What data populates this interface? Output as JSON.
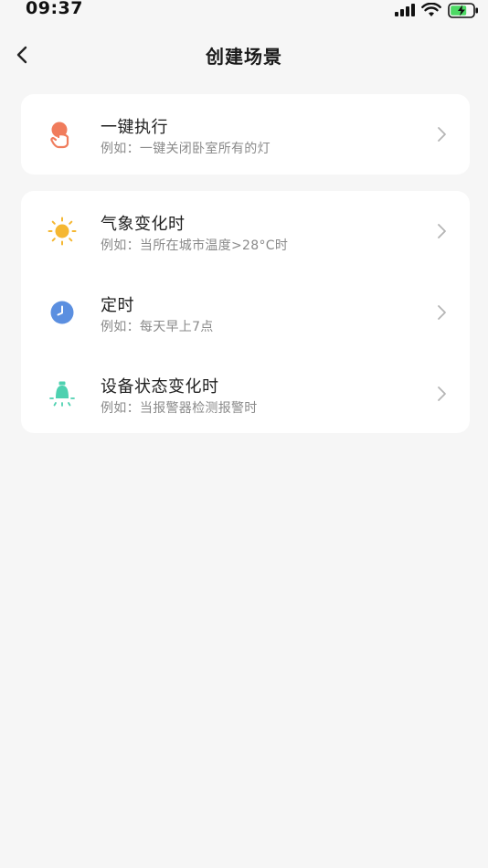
{
  "status_bar": {
    "time": "09:37"
  },
  "header": {
    "title": "创建场景"
  },
  "sections": [
    {
      "items": [
        {
          "icon": "tap-hand-icon",
          "icon_color": "#f07c5c",
          "title": "一键执行",
          "desc": "例如：一键关闭卧室所有的灯"
        }
      ]
    },
    {
      "items": [
        {
          "icon": "sun-icon",
          "icon_color": "#f5b731",
          "title": "气象变化时",
          "desc": "例如：当所在城市温度>28°C时"
        },
        {
          "icon": "clock-icon",
          "icon_color": "#5b8fe0",
          "title": "定时",
          "desc": "例如：每天早上7点"
        },
        {
          "icon": "device-icon",
          "icon_color": "#4ed1b0",
          "title": "设备状态变化时",
          "desc": "例如：当报警器检测报警时"
        }
      ]
    }
  ]
}
